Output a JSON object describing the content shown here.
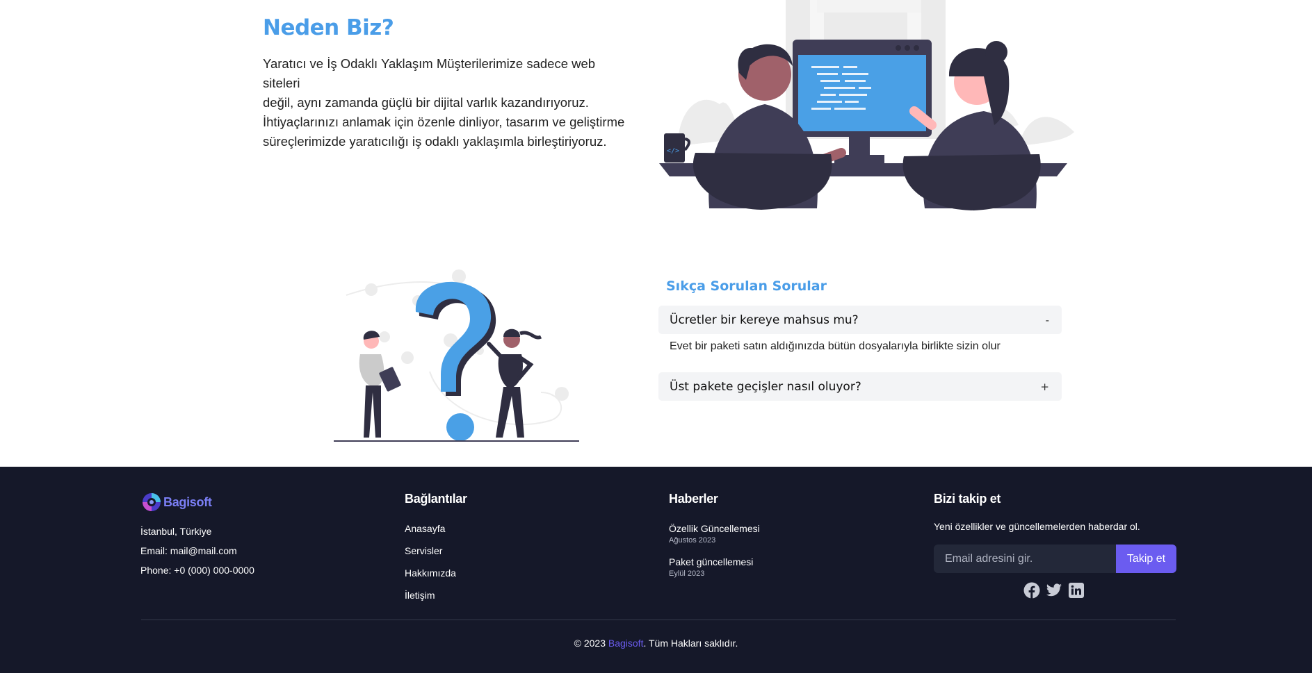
{
  "why": {
    "title": "Neden Biz?",
    "lines": [
      "Yaratıcı ve İş Odaklı Yaklaşım Müşterilerimize sadece web siteleri",
      "değil, aynı zamanda güçlü bir dijital varlık kazandırıyoruz.",
      "İhtiyaçlarınızı anlamak için özenle dinliyor, tasarım ve geliştirme",
      "süreçlerimizde yaratıcılığı iş odaklı yaklaşımla birleştiriyoruz."
    ]
  },
  "faq": {
    "title": "Sıkça Sorulan Sorular",
    "items": [
      {
        "question": "Ücretler bir kereye mahsus mu?",
        "sign": "-",
        "answer": "Evet bir paketi satın aldığınızda bütün dosyalarıyla birlikte sizin olur"
      },
      {
        "question": "Üst pakete geçişler nasıl oluyor?",
        "sign": "+"
      }
    ]
  },
  "footer": {
    "brand": "Bagisoft",
    "contact": {
      "location": "İstanbul, Türkiye",
      "email": "Email: mail@mail.com",
      "phone": "Phone: +0 (000) 000-0000"
    },
    "links_title": "Bağlantılar",
    "links": [
      "Anasayfa",
      "Servisler",
      "Hakkımızda",
      "İletişim"
    ],
    "news_title": "Haberler",
    "news": [
      {
        "title": "Özellik Güncellemesi",
        "date": "Ağustos 2023"
      },
      {
        "title": "Paket güncellemesi",
        "date": "Eylül 2023"
      }
    ],
    "follow_title": "Bizi takip et",
    "follow_text": "Yeni özellikler ve güncellemelerden haberdar ol.",
    "email_placeholder": "Email adresini gir.",
    "follow_button": "Takip et",
    "socials": [
      "facebook-icon",
      "twitter-icon",
      "linkedin-icon"
    ],
    "copyright_prefix": "© 2023 ",
    "copyright_brand": "Bagisoft",
    "copyright_suffix": ". Tüm Hakları saklıdır."
  },
  "colors": {
    "accent_blue": "#4a9de8",
    "footer_bg": "#151829",
    "button_purple": "#6b5cf0"
  }
}
